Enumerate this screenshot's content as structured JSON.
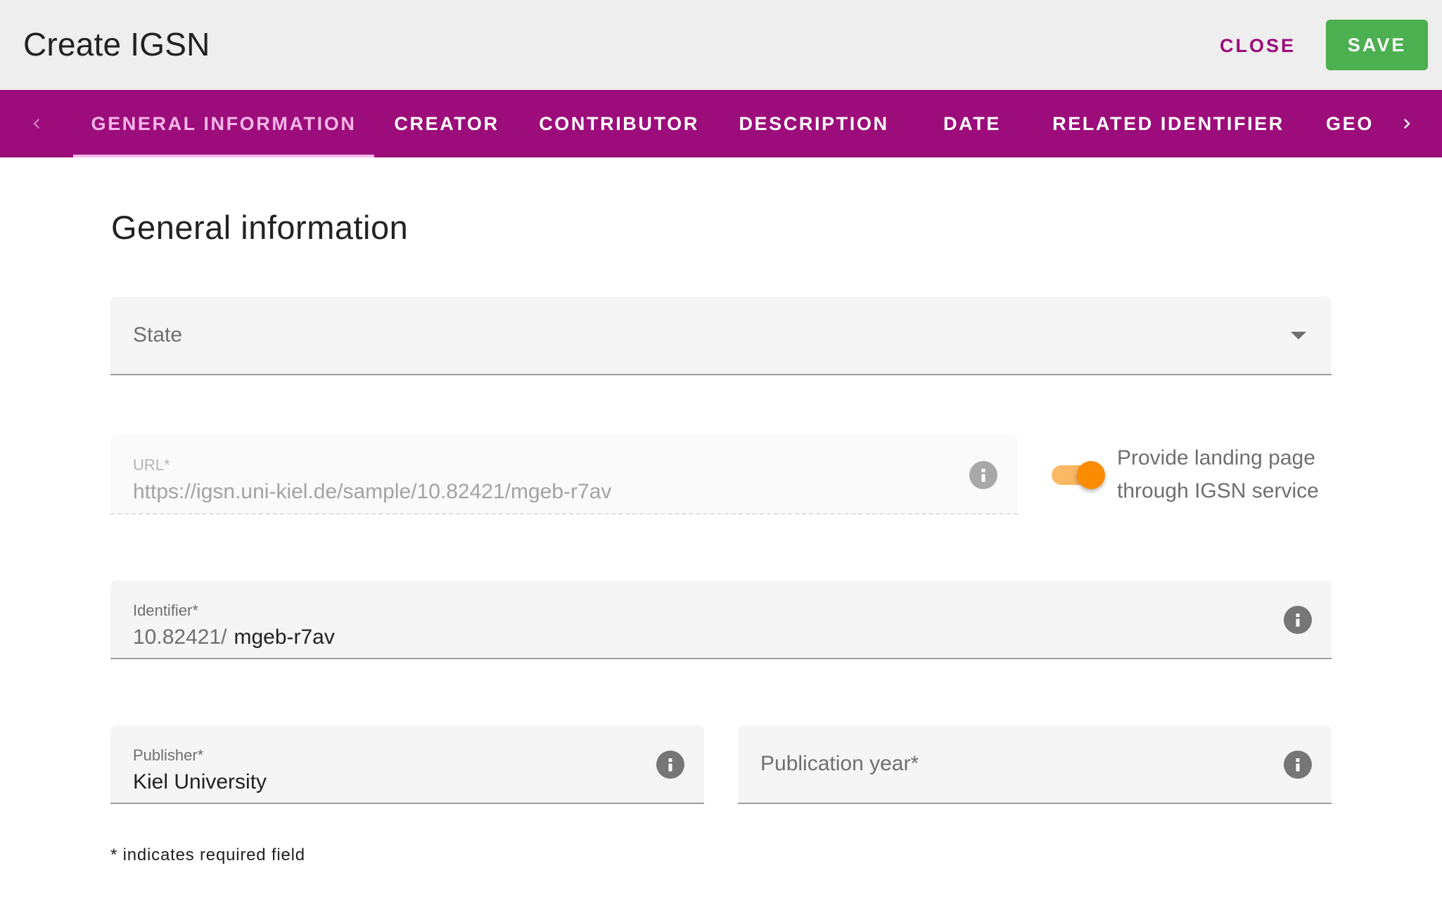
{
  "dialog": {
    "title": "Create IGSN",
    "close_label": "CLOSE",
    "save_label": "SAVE"
  },
  "colors": {
    "brand": "#9c0c7a",
    "active_tab": "#f7b6e8",
    "save": "#4caf50",
    "toggle_on": "#fb8c00"
  },
  "tabs": [
    {
      "label": "GENERAL INFORMATION",
      "active": true
    },
    {
      "label": "CREATOR",
      "active": false
    },
    {
      "label": "CONTRIBUTOR",
      "active": false
    },
    {
      "label": "DESCRIPTION",
      "active": false
    },
    {
      "label": "DATE",
      "active": false
    },
    {
      "label": "RELATED IDENTIFIER",
      "active": false
    },
    {
      "label": "GEO",
      "active": false
    }
  ],
  "tab_nav": {
    "prev_icon": "chevron-left-icon",
    "next_icon": "chevron-right-icon"
  },
  "section": {
    "heading": "General information"
  },
  "form": {
    "state": {
      "label": "State",
      "value": "",
      "icon": "dropdown-arrow-icon"
    },
    "url": {
      "label": "URL*",
      "value": "https://igsn.uni-kiel.de/sample/10.82421/mgeb-r7av",
      "disabled": true,
      "icon": "info-icon"
    },
    "landing_page_toggle": {
      "label": "Provide landing page through IGSN service",
      "checked": true
    },
    "identifier": {
      "label": "Identifier*",
      "prefix": "10.82421/",
      "value": "mgeb-r7av",
      "icon": "info-icon"
    },
    "publisher": {
      "label": "Publisher*",
      "value": "Kiel University",
      "icon": "info-icon"
    },
    "publication_year": {
      "label": "Publication year*",
      "value": "",
      "icon": "info-icon"
    }
  },
  "footnote": "* indicates required field"
}
